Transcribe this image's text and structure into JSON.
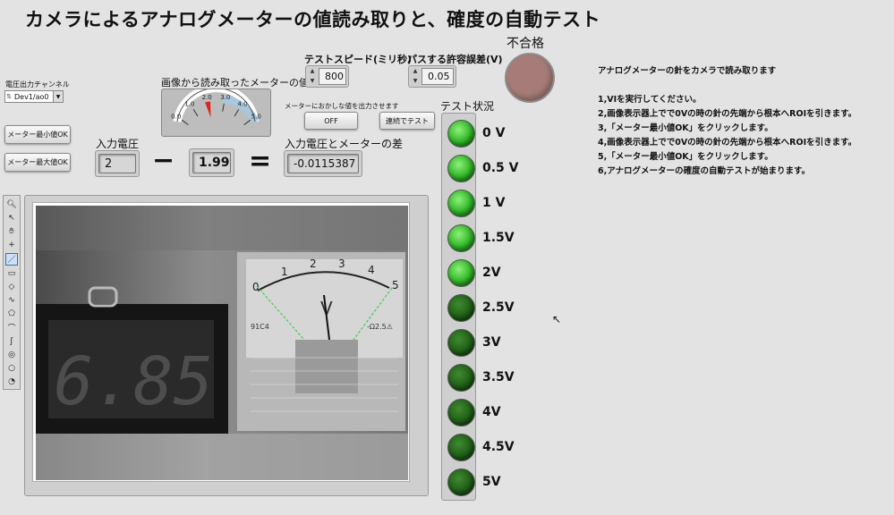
{
  "title": "カメラによるアナログメーターの値読み取りと、確度の自動テスト",
  "channel": {
    "label": "電圧出力チャンネル",
    "value": "Dev1/ao0"
  },
  "buttons": {
    "meter_min": "メーター最小値OK",
    "meter_max": "メーター最大値OK",
    "off": "OFF",
    "continuous": "連続でテスト"
  },
  "gauge": {
    "label": "画像から読み取ったメーターの値",
    "ticks": [
      "0.0",
      "1.0",
      "2.0",
      "3.0",
      "4.0",
      "5.0"
    ],
    "value": 1.99,
    "min": 0,
    "max": 5
  },
  "input_voltage": {
    "label": "入力電圧",
    "value": "2"
  },
  "meter_reading": "1.99",
  "difference": {
    "label": "入力電圧とメーターの差",
    "value": "-0.0115387"
  },
  "test_speed": {
    "label": "テストスピード(ミリ秒)",
    "value": "800"
  },
  "tolerance": {
    "label": "パスする許容誤差(V)",
    "value": "0.05"
  },
  "fail": {
    "label": "不合格",
    "color": "#a77c78"
  },
  "abnormal_label": "メーターにおかしな値を出力させます",
  "test_status": {
    "label": "テスト状況",
    "items": [
      {
        "label": "0 V",
        "on": true
      },
      {
        "label": "0.5 V",
        "on": true
      },
      {
        "label": "1 V",
        "on": true
      },
      {
        "label": "1.5V",
        "on": true
      },
      {
        "label": "2V",
        "on": true
      },
      {
        "label": "2.5V",
        "on": false
      },
      {
        "label": "3V",
        "on": false
      },
      {
        "label": "3.5V",
        "on": false
      },
      {
        "label": "4V",
        "on": false
      },
      {
        "label": "4.5V",
        "on": false
      },
      {
        "label": "5V",
        "on": false
      }
    ]
  },
  "instructions": {
    "heading": "アナログメーターの針をカメラで読み取ります",
    "steps": [
      "1,VIを実行してください。",
      "2,画像表示器上でで0Vの時の針の先端から根本へROIを引きます。",
      "3,「メーター最小値OK」をクリックします。",
      "4,画像表示器上でで0Vの時の針の先端から根本へROIを引きます。",
      "5,「メーター最小値OK」をクリックします。",
      "6,アナログメーターの確度の自動テストが始まります。"
    ]
  },
  "camera": {
    "display_digits": "6.85",
    "meter_scale": [
      "0",
      "1",
      "2",
      "3",
      "4",
      "5"
    ],
    "meter_unit": "V",
    "meter_code": "91C4",
    "meter_class": "-Ω2.5⚠"
  },
  "tools": [
    "zoom-icon",
    "pointer-icon",
    "pan-icon",
    "crosshair-icon",
    "line-icon",
    "rectangle-icon",
    "rotated-rect-icon",
    "freeline-icon",
    "polygon-icon",
    "polyline-icon",
    "freehand-icon",
    "annulus-icon",
    "oval-icon",
    "arc-icon"
  ]
}
